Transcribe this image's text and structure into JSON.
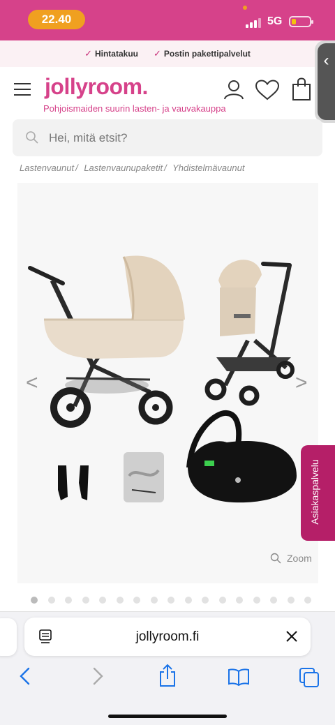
{
  "status": {
    "time": "22.40",
    "network": "5G",
    "battery_level": 0.25,
    "accent": "#d6428a"
  },
  "usp": {
    "items": [
      "Hintatakuu",
      "Postin pakettipalvelut"
    ]
  },
  "header": {
    "logo": "jollyroom.",
    "tagline": "Pohjoismaiden suurin lasten- ja vauvakauppa"
  },
  "search": {
    "placeholder": "Hei, mitä etsit?"
  },
  "breadcrumb": [
    "Lastenvaunut",
    "Lastenvaunupaketit",
    "Yhdistelmävaunut"
  ],
  "product": {
    "zoom_label": "Zoom",
    "image_count": 17,
    "active_image": 1
  },
  "service_tab": {
    "label": "Asiakaspalvelu"
  },
  "browser": {
    "url": "jollyroom.fi"
  }
}
